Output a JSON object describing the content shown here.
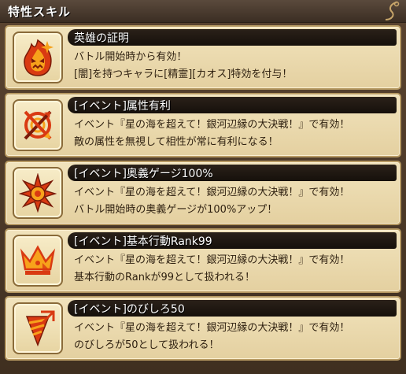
{
  "panel": {
    "title": "特性スキル"
  },
  "skills": [
    {
      "icon": "demon-flame-icon",
      "title": "英雄の証明",
      "lines": [
        "バトル開始時から有効！",
        "[闇]を持つキャラに[精霊][カオス]特効を付与！"
      ]
    },
    {
      "icon": "crossed-arrow-target-icon",
      "title": "[イベント]属性有利",
      "lines": [
        "イベント『星の海を超えて！銀河辺縁の大決戦！』で有効！",
        "敵の属性を無視して相性が常に有利になる！"
      ]
    },
    {
      "icon": "burst-star-icon",
      "title": "[イベント]奥義ゲージ100%",
      "lines": [
        "イベント『星の海を超えて！銀河辺縁の大決戦！』で有効！",
        "バトル開始時の奥義ゲージが100%アップ！"
      ]
    },
    {
      "icon": "crown-icon",
      "title": "[イベント]基本行動Rank99",
      "lines": [
        "イベント『星の海を超えて！銀河辺縁の大決戦！』で有効！",
        "基本行動のRankが99として扱われる！"
      ]
    },
    {
      "icon": "drill-arrow-icon",
      "title": "[イベント]のびしろ50",
      "lines": [
        "イベント『星の海を超えて！銀河辺縁の大決戦！』で有効！",
        "のびしろが50として扱われる！"
      ]
    }
  ],
  "colors": {
    "icon_red": "#d93a12",
    "icon_orange": "#f7a21b",
    "icon_dark": "#7a1a08"
  }
}
